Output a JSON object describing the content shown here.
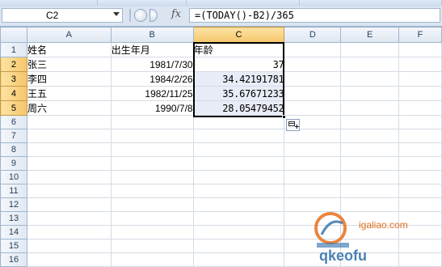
{
  "formula_bar": {
    "name_box": "C2",
    "fx_label": "fx",
    "formula": "=(TODAY()-B2)/365"
  },
  "columns": [
    "A",
    "B",
    "C",
    "D",
    "E",
    "F"
  ],
  "rows": [
    {
      "num": "1",
      "a": "姓名",
      "b": "出生年月",
      "c": "年龄"
    },
    {
      "num": "2",
      "a": "张三",
      "b": "1981/7/30",
      "c": "37"
    },
    {
      "num": "3",
      "a": "李四",
      "b": "1984/2/26",
      "c": "34.42191781"
    },
    {
      "num": "4",
      "a": "王五",
      "b": "1982/11/25",
      "c": "35.67671233"
    },
    {
      "num": "5",
      "a": "周六",
      "b": "1990/7/8",
      "c": "28.05479452"
    },
    {
      "num": "6",
      "a": "",
      "b": "",
      "c": ""
    },
    {
      "num": "7",
      "a": "",
      "b": "",
      "c": ""
    },
    {
      "num": "8",
      "a": "",
      "b": "",
      "c": ""
    },
    {
      "num": "9",
      "a": "",
      "b": "",
      "c": ""
    },
    {
      "num": "10",
      "a": "",
      "b": "",
      "c": ""
    },
    {
      "num": "11",
      "a": "",
      "b": "",
      "c": ""
    },
    {
      "num": "12",
      "a": "",
      "b": "",
      "c": ""
    },
    {
      "num": "13",
      "a": "",
      "b": "",
      "c": ""
    },
    {
      "num": "14",
      "a": "",
      "b": "",
      "c": ""
    },
    {
      "num": "15",
      "a": "",
      "b": "",
      "c": ""
    },
    {
      "num": "16",
      "a": "",
      "b": "",
      "c": ""
    }
  ],
  "watermark": {
    "line1": "igaliao.com",
    "line2": "qkeofu"
  },
  "icons": {
    "autofill": "autofill-options-icon",
    "fx": "function-icon",
    "dropdown": "chevron-down-icon"
  }
}
